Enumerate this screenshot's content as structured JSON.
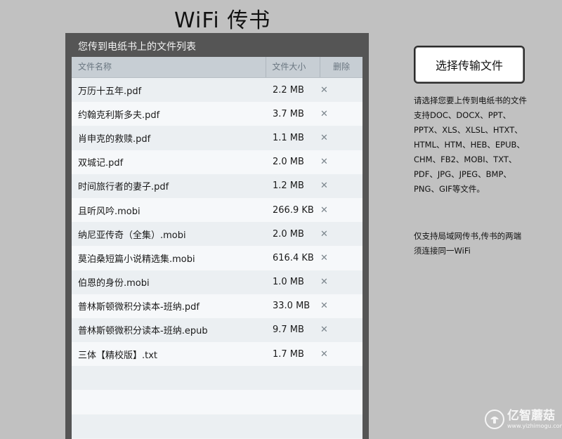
{
  "page": {
    "title": "WiFi 传书"
  },
  "panel": {
    "title": "您传到电纸书上的文件列表",
    "columns": {
      "name": "文件名称",
      "size": "文件大小",
      "delete": "删除"
    },
    "delete_glyph": "✕",
    "files": [
      {
        "name": "万历十五年.pdf",
        "size": "2.2 MB"
      },
      {
        "name": "约翰克利斯多夫.pdf",
        "size": "3.7 MB"
      },
      {
        "name": "肖申克的救赎.pdf",
        "size": "1.1 MB"
      },
      {
        "name": "双城记.pdf",
        "size": "2.0 MB"
      },
      {
        "name": "时间旅行者的妻子.pdf",
        "size": "1.2 MB"
      },
      {
        "name": "且听风吟.mobi",
        "size": "266.9 KB"
      },
      {
        "name": "纳尼亚传奇（全集）.mobi",
        "size": "2.0 MB"
      },
      {
        "name": "莫泊桑短篇小说精选集.mobi",
        "size": "616.4 KB"
      },
      {
        "name": "伯恩的身份.mobi",
        "size": "1.0 MB"
      },
      {
        "name": "普林斯顿微积分读本-班纳.pdf",
        "size": "33.0 MB"
      },
      {
        "name": "普林斯顿微积分读本-班纳.epub",
        "size": "9.7 MB"
      },
      {
        "name": "三体【精校版】.txt",
        "size": "1.7 MB"
      },
      {
        "name": "",
        "size": ""
      },
      {
        "name": "",
        "size": ""
      },
      {
        "name": "",
        "size": ""
      }
    ]
  },
  "sidebar": {
    "upload_label": "选择传输文件",
    "formats_lines": [
      "请选择您要上传到电纸书的文件",
      "支持DOC、DOCX、PPT、",
      "PPTX、XLS、XLSL、HTXT、",
      "HTML、HTM、HEB、EPUB、",
      "CHM、FB2、MOBI、TXT、",
      "PDF、JPG、JPEG、BMP、",
      "PNG、GIF等文件。"
    ],
    "network_lines": [
      "仅支持局域网传书,传书的两端",
      "须连接同一WiFi"
    ]
  },
  "watermark": {
    "name": "亿智蘑菇",
    "url": "www.yizhimogu.com"
  },
  "colors": {
    "background": "#c1c1c1",
    "panel": "#555555",
    "table_header": "#c7ced4"
  }
}
